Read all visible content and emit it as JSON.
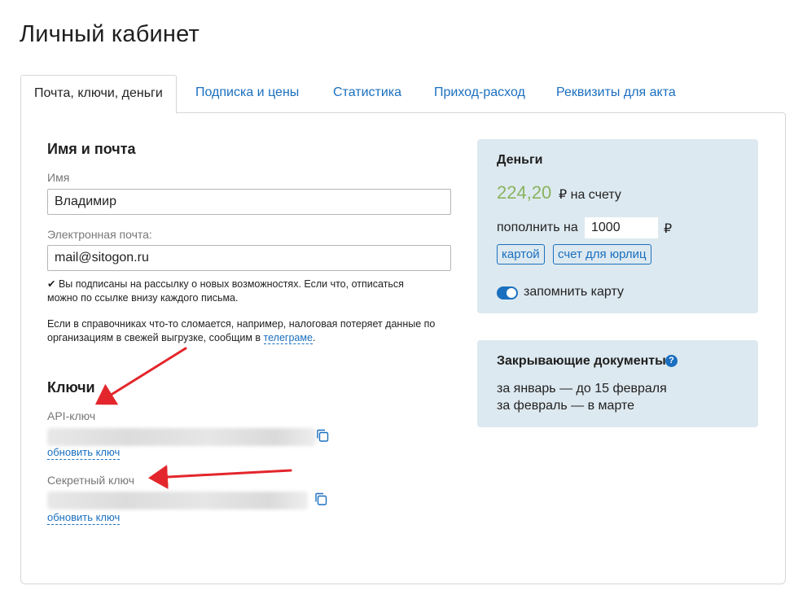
{
  "page": {
    "title": "Личный кабинет"
  },
  "tabs": [
    {
      "label": "Почта, ключи, деньги",
      "active": true
    },
    {
      "label": "Подписка и цены",
      "active": false
    },
    {
      "label": "Статистика",
      "active": false
    },
    {
      "label": "Приход-расход",
      "active": false
    },
    {
      "label": "Реквизиты для акта",
      "active": false
    }
  ],
  "profile": {
    "section_title": "Имя и почта",
    "name_label": "Имя",
    "name_value": "Владимир",
    "email_label": "Электронная почта:",
    "email_value": "mail@sitogon.ru",
    "subscription_note_check": "✔",
    "subscription_note_line1": "Вы подписаны на рассылку о новых возможностях. Если что, отписаться",
    "subscription_note_line2": "можно по ссылке внизу каждого письма.",
    "directory_note_line1": "Если в справочниках что-то сломается, например, налоговая потеряет данные по",
    "directory_note_line2": "организациям в свежей выгрузке, сообщим в",
    "telegram_link": "телеграме",
    "directory_note_end": "."
  },
  "keys": {
    "section_title": "Ключи",
    "api_label": "API-ключ",
    "api_update_link": "обновить ключ",
    "secret_label": "Секретный ключ",
    "secret_update_link": "обновить ключ"
  },
  "money": {
    "title": "Деньги",
    "balance": "224,20",
    "balance_suffix": "₽ на счету",
    "topup_label": "пополнить на",
    "topup_amount": "1000",
    "currency": "₽",
    "pay_card_button": "картой",
    "pay_invoice_button": "счет для юрлиц",
    "remember_card_label": "запомнить карту",
    "remember_card_enabled": true
  },
  "docs": {
    "title": "Закрывающие документы",
    "help_glyph": "?",
    "line1": "за январь — до 15 февраля",
    "line2": "за февраль — в марте"
  },
  "colors": {
    "accent": "#1a6fbf",
    "balance_green": "#8ab35e",
    "info_box_bg": "#dde9f0",
    "annotation_arrow": "#e3262b"
  }
}
